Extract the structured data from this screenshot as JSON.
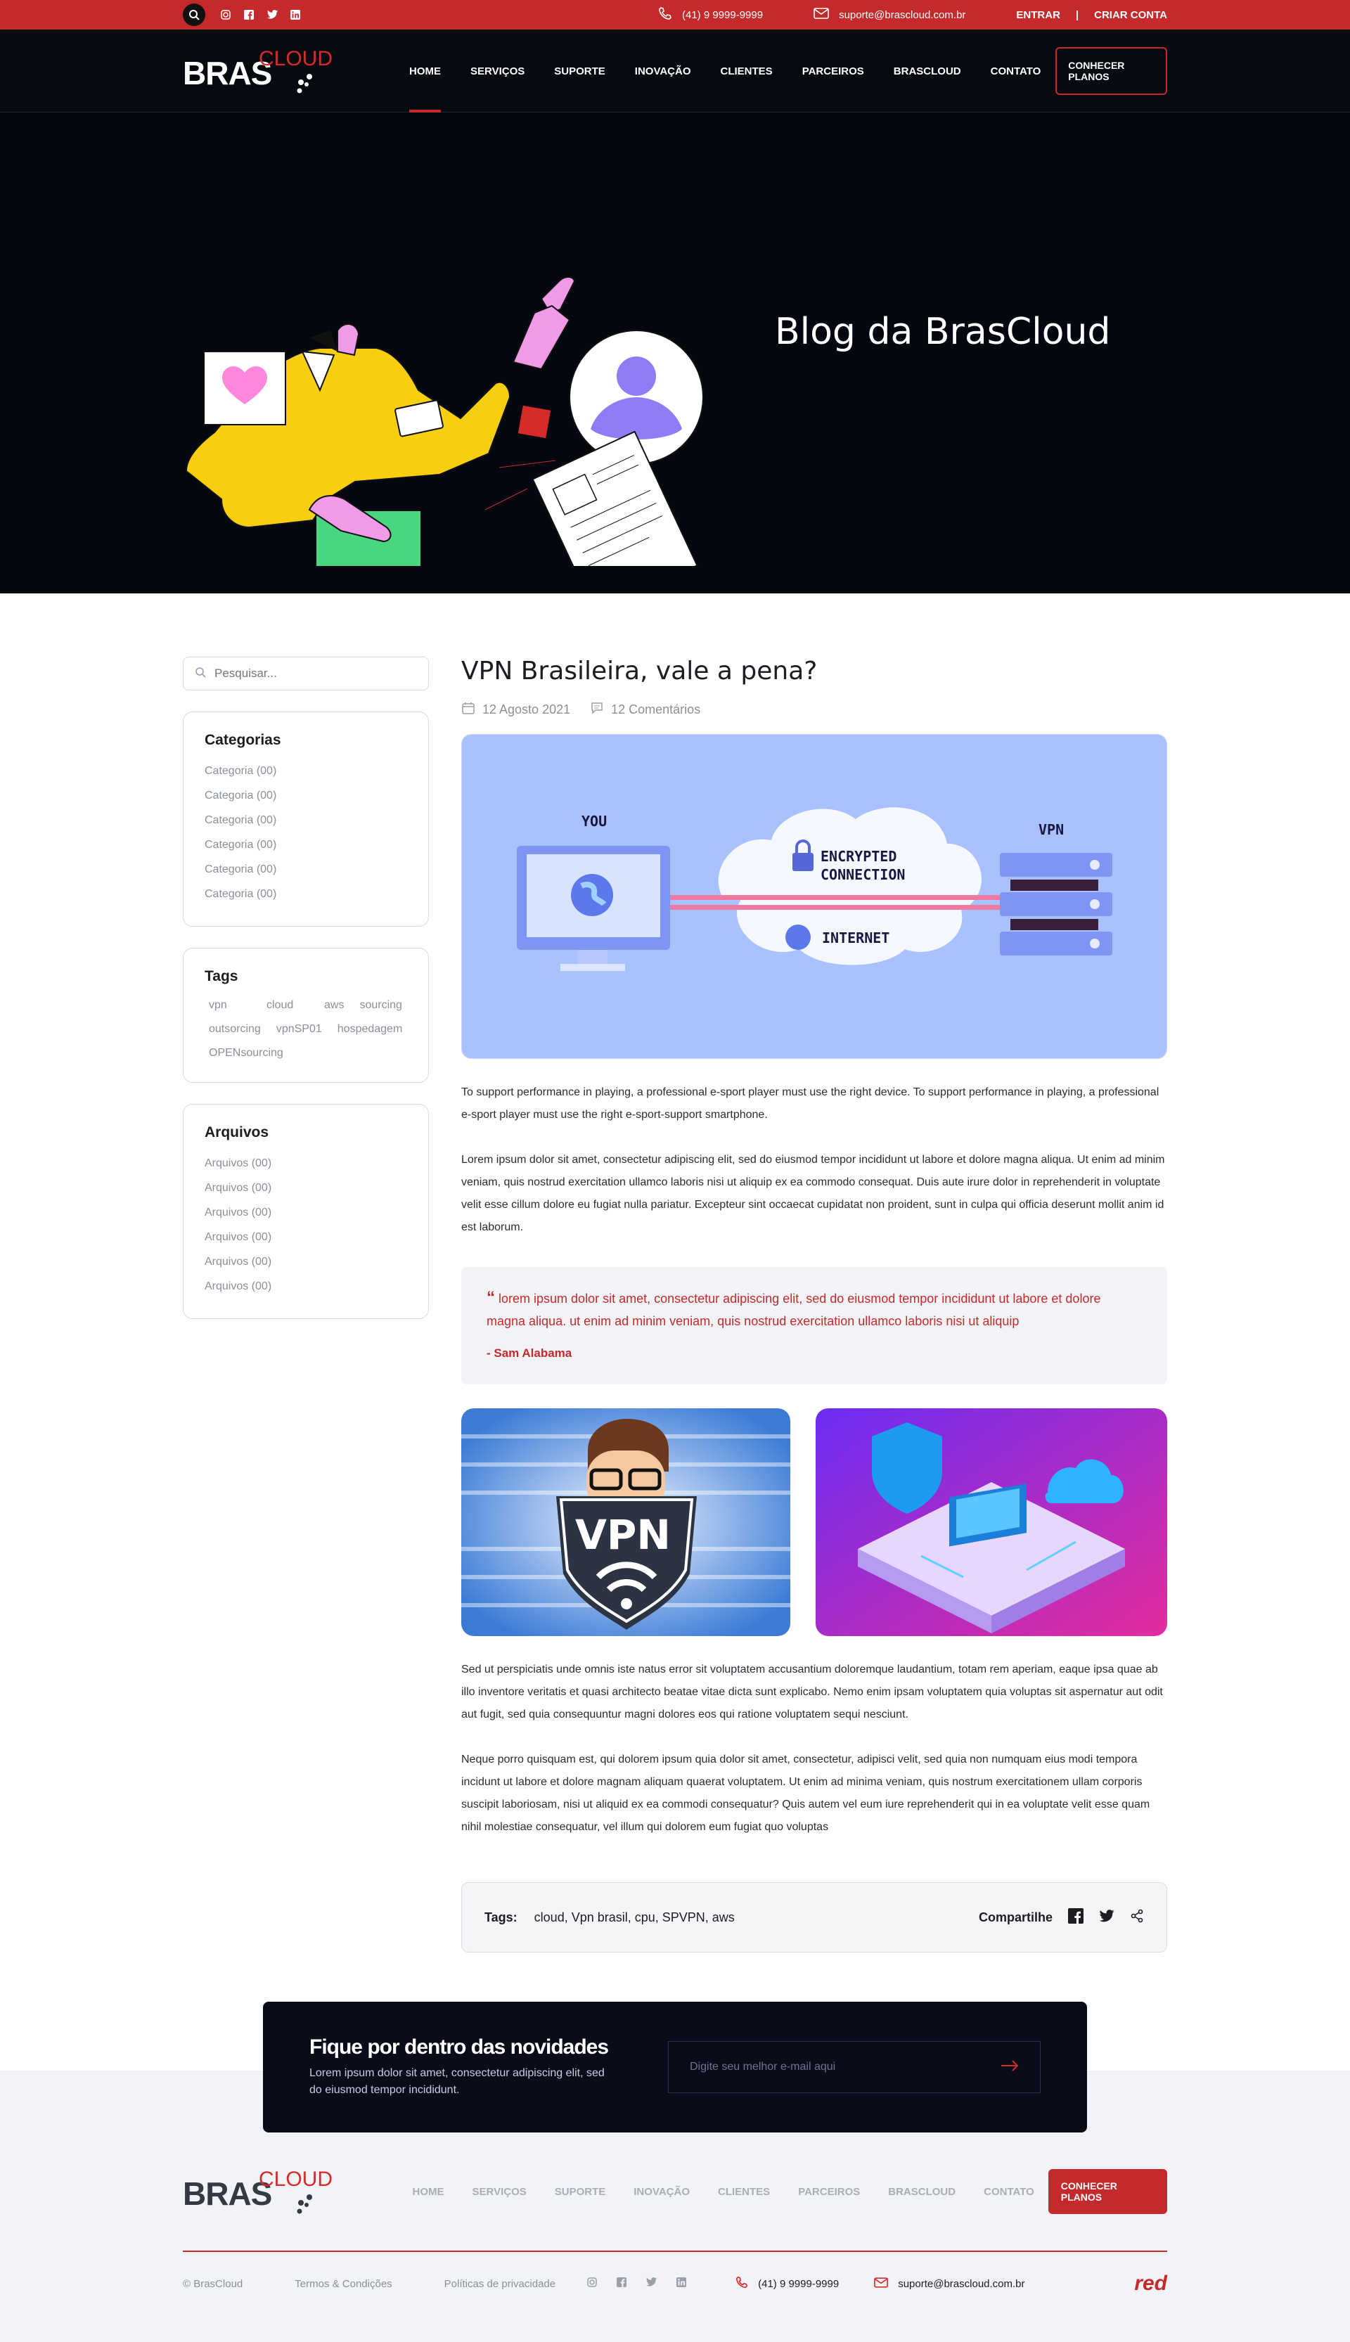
{
  "topbar": {
    "phone": "(41) 9 9999-9999",
    "email": "suporte@brascloud.com.br",
    "login": "ENTRAR",
    "separator": "|",
    "signup": "CRIAR CONTA",
    "social_icons": [
      "instagram-icon",
      "facebook-icon",
      "twitter-icon",
      "linkedin-icon"
    ]
  },
  "brand": {
    "bras": "BRAS",
    "cloud": "CLOUD"
  },
  "nav": {
    "items": [
      "HOME",
      "SERVIÇOS",
      "SUPORTE",
      "INOVAÇÃO",
      "CLIENTES",
      "PARCEIROS",
      "BRASCLOUD",
      "CONTATO"
    ],
    "cta": "CONHECER PLANOS"
  },
  "hero": {
    "title": "Blog da BrasCloud"
  },
  "sidebar": {
    "search_placeholder": "Pesquisar...",
    "categories_title": "Categorias",
    "categories": [
      "Categoria (00)",
      "Categoria (00)",
      "Categoria (00)",
      "Categoria (00)",
      "Categoria (00)",
      "Categoria (00)"
    ],
    "tags_title": "Tags",
    "tags": [
      "vpn",
      "cloud",
      "aws",
      "sourcing",
      "outsorcing",
      "vpnSP01",
      "hospedagem",
      "OPENsourcing"
    ],
    "archives_title": "Arquivos",
    "archives": [
      "Arquivos (00)",
      "Arquivos (00)",
      "Arquivos (00)",
      "Arquivos (00)",
      "Arquivos (00)",
      "Arquivos (00)"
    ]
  },
  "post": {
    "title": "VPN Brasileira, vale a pena?",
    "date": "12 Agosto 2021",
    "comments": "12 Comentários",
    "diagram": {
      "you": "YOU",
      "vpn": "VPN",
      "encrypted1": "ENCRYPTED",
      "encrypted2": "CONNECTION",
      "internet": "INTERNET"
    },
    "p1": "To support performance in playing, a professional e-sport player must use the right device. To support performance in playing, a professional e-sport player must use the right e-sport-support smartphone.",
    "p2": "Lorem ipsum dolor sit amet, consectetur adipiscing elit, sed do eiusmod tempor incididunt ut labore et dolore magna aliqua. Ut enim ad minim veniam, quis nostrud exercitation ullamco laboris nisi ut aliquip ex ea commodo consequat. Duis aute irure dolor in reprehenderit in voluptate velit esse cillum dolore eu fugiat nulla pariatur. Excepteur sint occaecat cupidatat non proident, sunt in culpa qui officia deserunt mollit anim id est laborum.",
    "quote": "lorem ipsum dolor sit amet, consectetur adipiscing elit, sed do eiusmod tempor incididunt ut labore et dolore magna aliqua. ut enim ad minim veniam, quis nostrud exercitation ullamco laboris nisi ut aliquip",
    "quote_mark": "“",
    "quote_author": "- Sam Alabama",
    "vpn_badge": "VPN",
    "p3": "Sed ut perspiciatis unde omnis iste natus error sit voluptatem accusantium doloremque laudantium, totam rem aperiam, eaque ipsa quae ab illo inventore veritatis et quasi architecto beatae vitae dicta sunt explicabo. Nemo enim ipsam voluptatem quia voluptas sit aspernatur aut odit aut fugit, sed quia consequuntur magni dolores eos qui ratione voluptatem sequi nesciunt.",
    "p4": "Neque porro quisquam est, qui dolorem ipsum quia dolor sit amet, consectetur, adipisci velit, sed quia non numquam eius modi tempora incidunt ut labore et dolore magnam aliquam quaerat voluptatem. Ut enim ad minima veniam, quis nostrum exercitationem ullam corporis suscipit laboriosam, nisi ut aliquid ex ea commodi consequatur? Quis autem vel eum iure reprehenderit qui in ea voluptate velit esse quam nihil molestiae consequatur, vel illum qui dolorem eum fugiat quo voluptas",
    "tags_label": "Tags:",
    "tags_list": "cloud, Vpn brasil, cpu, SPVPN, aws",
    "share_label": "Compartilhe"
  },
  "newsletter": {
    "title": "Fique por dentro das novidades",
    "text": "Lorem ipsum dolor sit amet, consectetur adipiscing elit, sed do eiusmod tempor incididunt.",
    "placeholder": "Digite seu melhor e-mail aqui"
  },
  "footer": {
    "nav": [
      "HOME",
      "SERVIÇOS",
      "SUPORTE",
      "INOVAÇÃO",
      "CLIENTES",
      "PARCEIROS",
      "BRASCLOUD",
      "CONTATO"
    ],
    "cta": "CONHECER PLANOS",
    "copyright": "© BrasCloud",
    "terms": "Termos & Condições",
    "privacy": "Políticas de privacidade",
    "phone": "(41) 9 9999-9999",
    "email": "suporte@brascloud.com.br",
    "partner": "red"
  },
  "colors": {
    "accent": "#c42a2b",
    "dark": "#080a12",
    "light": "#f2f3f6"
  }
}
